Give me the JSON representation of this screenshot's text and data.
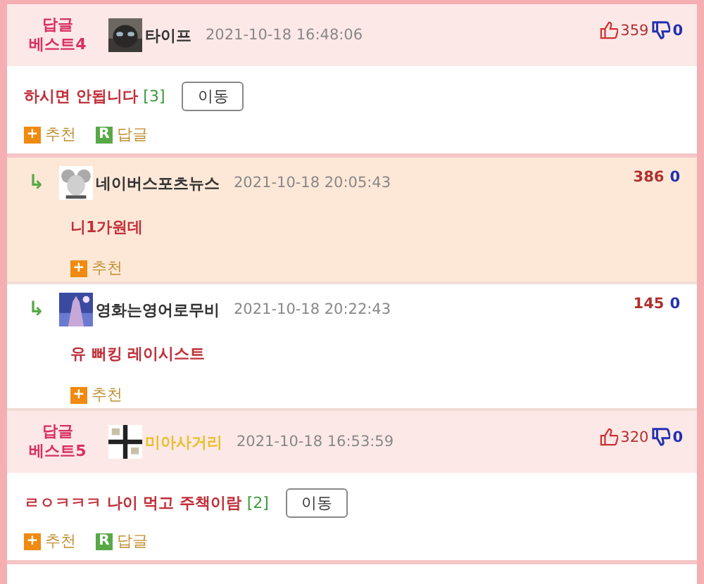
{
  "items": [
    {
      "kind": "best",
      "badge": [
        "답글",
        "베스트4"
      ],
      "author": {
        "name": "타이프",
        "color": "#333333"
      },
      "time": "2021-10-18 16:48:06",
      "likes": "359",
      "dislikes": "0",
      "title": "하시면 안됩니다",
      "count": "[3]",
      "move": "이동",
      "actions": [
        {
          "icon": "+",
          "label": "추천",
          "kind": "recommend"
        },
        {
          "icon": "R",
          "label": "답글",
          "kind": "reply"
        }
      ]
    },
    {
      "kind": "reply",
      "highlighted": true,
      "arrow": "↳",
      "author": {
        "name": "네이버스포츠뉴스",
        "color": "#333333"
      },
      "time": "2021-10-18 20:05:43",
      "likes": "386",
      "dislikes": "0",
      "text": "니1가원데",
      "actions": [
        {
          "icon": "+",
          "label": "추천",
          "kind": "recommend"
        }
      ]
    },
    {
      "kind": "reply",
      "highlighted": false,
      "arrow": "↳",
      "author": {
        "name": "영화는영어로무비",
        "color": "#333333"
      },
      "time": "2021-10-18 20:22:43",
      "likes": "145",
      "dislikes": "0",
      "text": "유 뻐킹 레이시스트",
      "actions": [
        {
          "icon": "+",
          "label": "추천",
          "kind": "recommend"
        }
      ]
    },
    {
      "kind": "best",
      "badge": [
        "답글",
        "베스트5"
      ],
      "author": {
        "name": "미아사거리",
        "color": "#e8c030"
      },
      "time": "2021-10-18 16:53:59",
      "likes": "320",
      "dislikes": "0",
      "title": "ㄹㅇㅋㅋㅋ 나이 먹고 주책이람",
      "count": "[2]",
      "move": "이동",
      "actions": [
        {
          "icon": "+",
          "label": "추천",
          "kind": "recommend"
        },
        {
          "icon": "R",
          "label": "답글",
          "kind": "reply"
        }
      ]
    }
  ]
}
